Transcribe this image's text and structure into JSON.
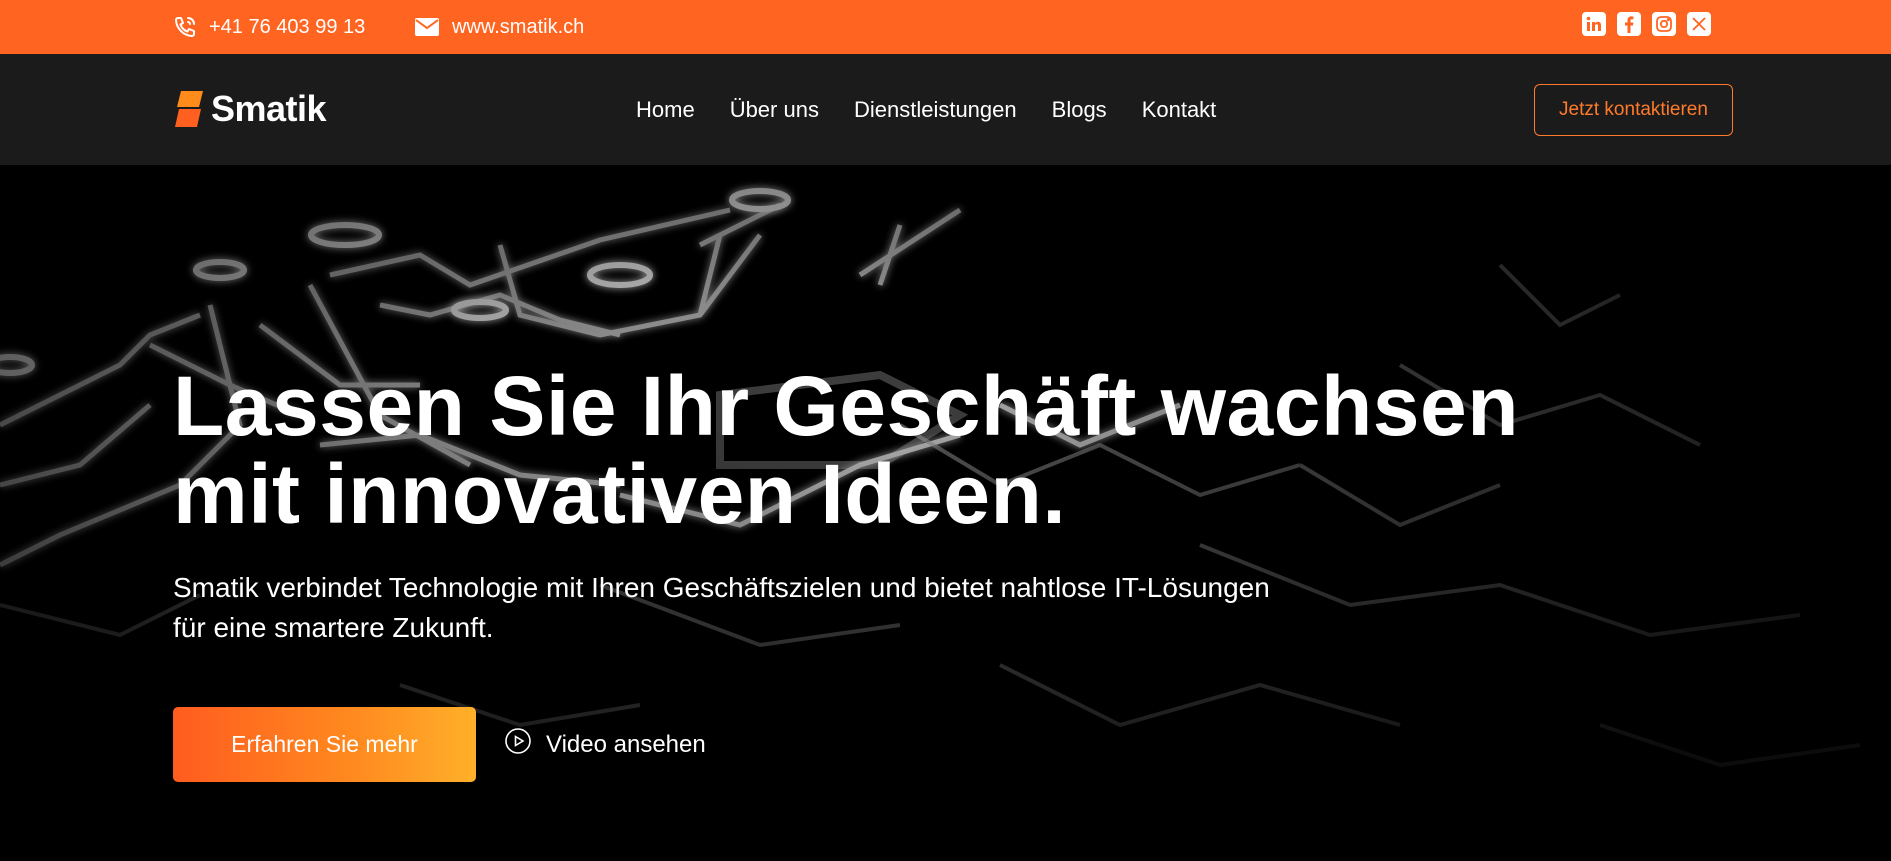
{
  "topbar": {
    "phone": "+41 76 403 99 13",
    "website": "www.smatik.ch",
    "phone_icon": "phone-icon",
    "email_icon": "email-icon",
    "socials": [
      "linkedin-icon",
      "facebook-icon",
      "instagram-icon",
      "x-icon"
    ]
  },
  "nav": {
    "logo_text": "Smatik",
    "items": [
      "Home",
      "Über uns",
      "Dienstleistungen",
      "Blogs",
      "Kontakt"
    ],
    "cta": "Jetzt kontaktieren"
  },
  "hero": {
    "title_line1": "Lassen Sie Ihr Geschäft wachsen",
    "title_line2": "mit innovativen Ideen.",
    "subtitle_line1": "Smatik verbindet Technologie mit Ihren Geschäftszielen und bietet nahtlose IT-Lösungen",
    "subtitle_line2": "für eine smartere Zukunft.",
    "primary_button": "Erfahren Sie mehr",
    "video_button": "Video ansehen",
    "video_icon": "play-circle-icon"
  },
  "colors": {
    "accent": "#ff6420",
    "nav_bg": "#1b1b1b",
    "hero_bg": "#000000",
    "gradient_end": "#ffb02a"
  }
}
